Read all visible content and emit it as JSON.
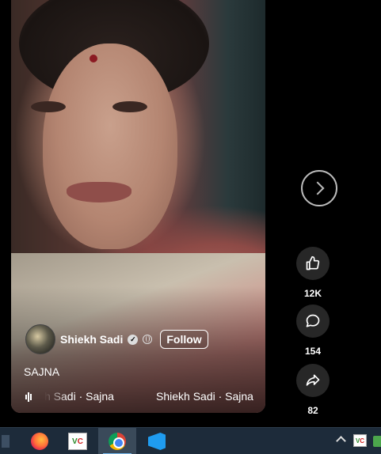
{
  "video": {
    "author_name": "Shiekh Sadi",
    "follow_label": "Follow",
    "caption": "SAJNA",
    "music_text_faded": "h Sadi · Sajna",
    "music_text": "Shiekh Sadi · Sajna"
  },
  "actions": {
    "likes": "12K",
    "comments": "154",
    "shares": "82"
  },
  "taskbar": {
    "apps": [
      "firefox-icon",
      "vc-icon",
      "chrome-icon",
      "vscode-icon"
    ],
    "active_app": "chrome-icon",
    "vc_v": "V",
    "vc_c": "C"
  },
  "colors": {
    "taskbar_bg": "#1d2b3a",
    "action_circle_bg": "#272727",
    "page_bg": "#000000"
  }
}
